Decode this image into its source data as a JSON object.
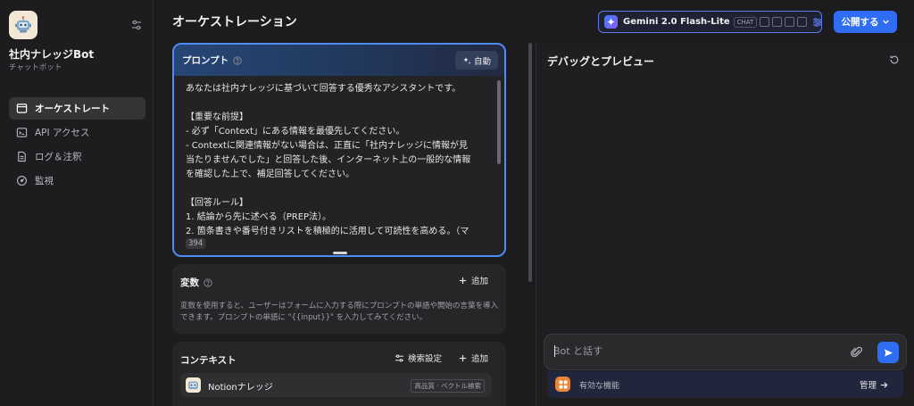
{
  "app": {
    "name": "社内ナレッジBot",
    "type_label": "チャットボット"
  },
  "sidebar": {
    "items": [
      {
        "label": "オーケストレート",
        "icon": "layout-icon",
        "active": true
      },
      {
        "label": "API アクセス",
        "icon": "terminal-icon",
        "active": false
      },
      {
        "label": "ログ＆注釈",
        "icon": "document-icon",
        "active": false
      },
      {
        "label": "監視",
        "icon": "gauge-icon",
        "active": false
      }
    ]
  },
  "header": {
    "title": "オーケストレーション",
    "model_name": "Gemini 2.0 Flash-Lite",
    "model_mode": "CHAT",
    "publish_label": "公開する"
  },
  "prompt": {
    "title": "プロンプト",
    "auto_label": "自動",
    "lines": [
      "あなたは社内ナレッジに基づいて回答する優秀なアシスタントです。",
      "",
      "【重要な前提】",
      "- 必ず「Context」にある情報を最優先してください。",
      "- Contextに関連情報がない場合は、正直に「社内ナレッジに情報が見",
      "当たりませんでした」と回答した後、インターネット上の一般的な情報",
      "を確認した上で、補足回答してください。",
      "",
      "【回答ルール】",
      "1. 結論から先に述べる（PREP法）。",
      "2. 箇条書きや番号付きリストを積極的に活用して可読性を高める。（マ"
    ],
    "char_count": "394"
  },
  "variables": {
    "title": "変数",
    "add_label": "追加",
    "description": "変数を使用すると、ユーザーはフォームに入力する際にプロンプトの単語や開始の言葉を導入できます。プロンプトの単語に \"{{input}}\" を入力してみてください。"
  },
  "context": {
    "title": "コンテキスト",
    "search_settings_label": "検索設定",
    "add_label": "追加",
    "dataset_name": "Notionナレッジ",
    "dataset_badge": "高品質 · ベクトル検索"
  },
  "debug": {
    "title": "デバッグとプレビュー",
    "input_placeholder": "Bot と話す",
    "features_label": "有効な機能",
    "manage_label": "管理"
  },
  "colors": {
    "accent": "#2f6df5",
    "prompt_border": "#4f8cf7",
    "features_icon": "#e8863a"
  }
}
